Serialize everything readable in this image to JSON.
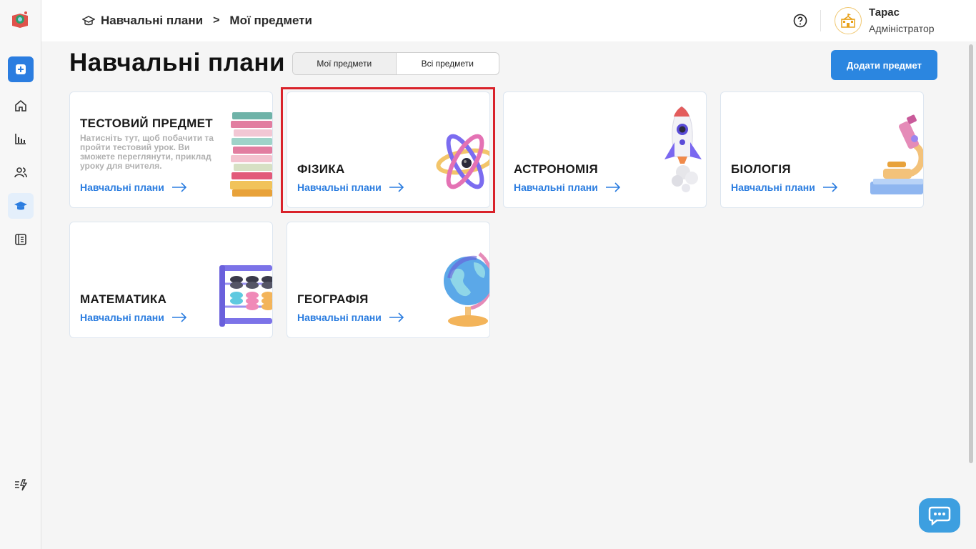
{
  "header": {
    "breadcrumb": [
      "Навчальні плани",
      "Мої предмети"
    ],
    "breadcrumb_separator": ">",
    "user_name": "Тарас",
    "user_role": "Адміністратор"
  },
  "page": {
    "title": "Навчальні плани",
    "tabs": [
      {
        "label": "Мої предмети",
        "active": true
      },
      {
        "label": "Всі предмети",
        "active": false
      }
    ],
    "add_button": "Додати предмет"
  },
  "cards": [
    {
      "title": "ТЕСТОВИЙ ПРЕДМЕТ",
      "description": "Натисніть тут, щоб побачити та пройти тестовий урок. Ви зможете переглянути, приклад уроку для вчителя.",
      "link": "Навчальні плани",
      "icon": "books-icon"
    },
    {
      "title": "ФІЗИКА",
      "link": "Навчальні плани",
      "icon": "atom-icon",
      "highlighted": true
    },
    {
      "title": "АСТРОНОМІЯ",
      "link": "Навчальні плани",
      "icon": "rocket-icon"
    },
    {
      "title": "БІОЛОГІЯ",
      "link": "Навчальні плани",
      "icon": "microscope-icon"
    },
    {
      "title": "МАТЕМАТИКА",
      "link": "Навчальні плани",
      "icon": "abacus-icon"
    },
    {
      "title": "ГЕОГРАФІЯ",
      "link": "Навчальні плани",
      "icon": "globe-icon"
    }
  ],
  "colors": {
    "accent": "#2b7de0",
    "highlight": "#d9222a",
    "background": "#f5f5f5"
  }
}
